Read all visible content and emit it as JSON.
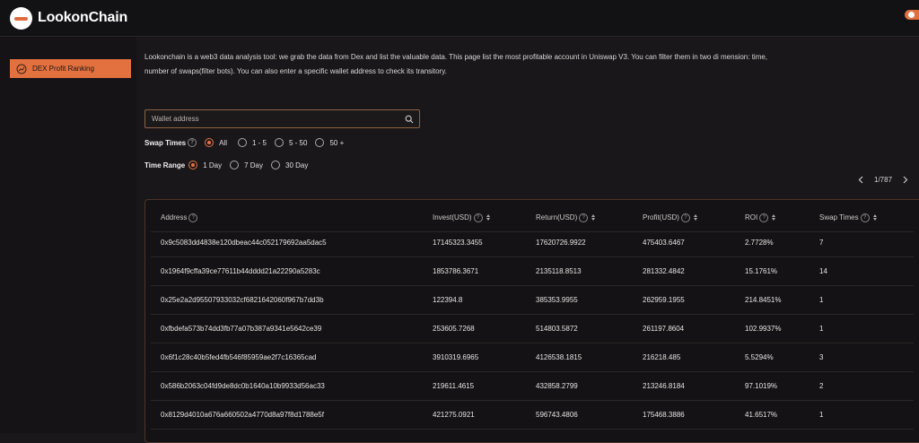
{
  "app": {
    "title": "LookonChain",
    "logo_text": "LOOKONCHAIN",
    "colors": {
      "accent": "#e2713f",
      "background": "#19171a",
      "text": "#e8e6e6"
    }
  },
  "sidebar": {
    "items": [
      {
        "label": "DEX Profit Ranking",
        "icon": "profit-chart-icon",
        "active": true
      }
    ]
  },
  "main": {
    "description": "Lookonchain is a web3 data analysis tool: we grab the data from Dex and list the valuable data. This page list the most profitable account in Uniswap V3. You can filter them in two di mension: time, number of swaps(filter bots). You can also enter a specific wallet address to check its transitory.",
    "search": {
      "placeholder": "Wallet address",
      "value": "",
      "icon": "search-icon"
    },
    "swap_times": {
      "label": "Swap Times",
      "options": [
        {
          "label": "All",
          "selected": true
        },
        {
          "label": "1 - 5",
          "selected": false
        },
        {
          "label": "5 - 50",
          "selected": false
        },
        {
          "label": "50 +",
          "selected": false
        }
      ]
    },
    "time_range": {
      "label": "Time Range",
      "options": [
        {
          "label": "1 Day",
          "selected": true
        },
        {
          "label": "7 Day",
          "selected": false
        },
        {
          "label": "30 Day",
          "selected": false
        }
      ]
    },
    "pagination": {
      "text": "1/787"
    },
    "table": {
      "columns": [
        {
          "label": "Address",
          "help": true,
          "sortable": false
        },
        {
          "label": "Invest(USD)",
          "help": true,
          "sortable": true
        },
        {
          "label": "Return(USD)",
          "help": true,
          "sortable": true
        },
        {
          "label": "Profit(USD)",
          "help": true,
          "sortable": true
        },
        {
          "label": "ROI",
          "help": true,
          "sortable": true
        },
        {
          "label": "Swap Times",
          "help": true,
          "sortable": true
        }
      ],
      "rows": [
        [
          "0x9c5083dd4838e120dbeac44c052179692aa5dac5",
          "17145323.3455",
          "17620726.9922",
          "475403.6467",
          "2.7728%",
          "7"
        ],
        [
          "0x1964f9cffa39ce77611b44dddd21a22290a5283c",
          "1853786.3671",
          "2135118.8513",
          "281332.4842",
          "15.1761%",
          "14"
        ],
        [
          "0x25e2a2d95507933032cf6821642060f967b7dd3b",
          "122394.8",
          "385353.9955",
          "262959.1955",
          "214.8451%",
          "1"
        ],
        [
          "0xfbdefa573b74dd3fb77a07b387a9341e5642ce39",
          "253605.7268",
          "514803.5872",
          "261197.8604",
          "102.9937%",
          "1"
        ],
        [
          "0x6f1c28c40b5fed4fb546f85959ae2f7c16365cad",
          "3910319.6965",
          "4126538.1815",
          "216218.485",
          "5.5294%",
          "3"
        ],
        [
          "0x586b2063c04fd9de8dc0b1640a10b9933d56ac33",
          "219611.4615",
          "432858.2799",
          "213246.8184",
          "97.1019%",
          "2"
        ],
        [
          "0x8129d4010a676a660502a4770d8a97f8d1788e5f",
          "421275.0921",
          "596743.4806",
          "175468.3886",
          "41.6517%",
          "1"
        ]
      ]
    }
  }
}
